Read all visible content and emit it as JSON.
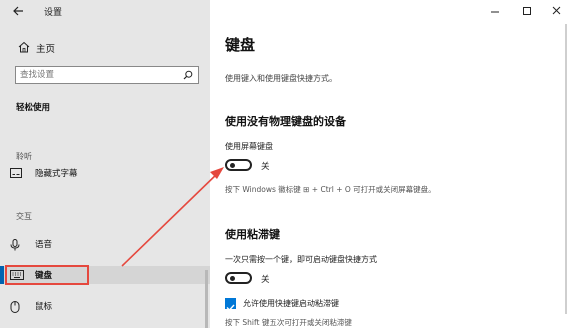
{
  "window": {
    "title": "设置"
  },
  "sidebar": {
    "home_label": "主页",
    "search_placeholder": "查找设置",
    "section_title": "轻松使用",
    "groups": [
      {
        "label": "聆听",
        "items": [
          {
            "label": "隐藏式字幕",
            "icon": "closed-captions-icon"
          }
        ]
      },
      {
        "label": "交互",
        "items": [
          {
            "label": "语音",
            "icon": "microphone-icon"
          },
          {
            "label": "键盘",
            "icon": "keyboard-icon",
            "selected": true
          },
          {
            "label": "鼠标",
            "icon": "mouse-icon"
          }
        ]
      }
    ]
  },
  "main": {
    "title": "键盘",
    "description": "使用键入和使用键盘快捷方式。",
    "section1": {
      "heading": "使用没有物理键盘的设备",
      "label": "使用屏幕键盘",
      "toggle_state": "关",
      "hint": "按下 Windows 徽标键 ⊞ + Ctrl + O 可打开或关闭屏幕键盘。"
    },
    "section2": {
      "heading": "使用粘滞键",
      "label": "一次只需按一个键，即可启动键盘快捷方式",
      "toggle_state": "关",
      "checkbox_label": "允许使用快捷键启动粘滞键",
      "hint": "按下 Shift 键五次可打开或关闭粘滞键"
    }
  },
  "colors": {
    "accent": "#0078d7",
    "highlight": "#e5483e",
    "sidebar_bg": "#e6e6e6"
  }
}
